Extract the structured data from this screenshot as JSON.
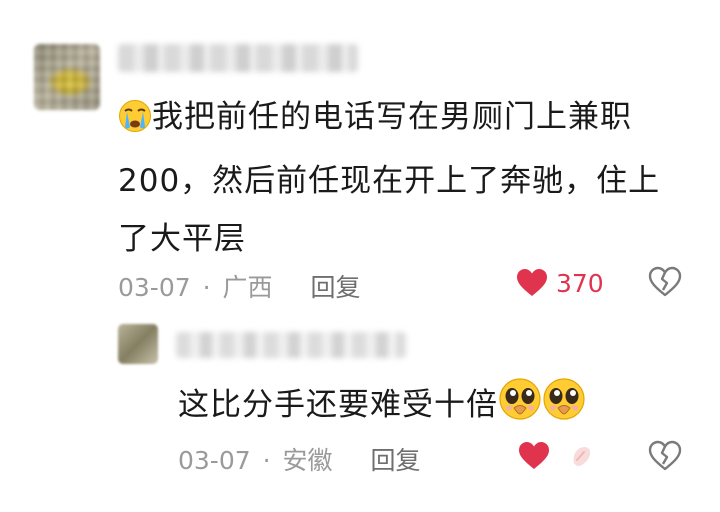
{
  "comment": {
    "text_lines": [
      "我把前任的电话写在男厕门上兼职",
      "200，然后前任现在开上了奔驰，住上",
      "了大平层"
    ],
    "date": "03-07",
    "separator": "·",
    "location": "广西",
    "reply_label": "回复",
    "like_count": "370",
    "liked": true,
    "leading_icon": "crying-face-icon"
  },
  "reply": {
    "text": "这比分手还要难受十倍",
    "trailing_icons": [
      "pleading-face-icon",
      "pleading-face-icon"
    ],
    "date": "03-07",
    "separator": "·",
    "location": "安徽",
    "reply_label": "回复",
    "liked": true
  },
  "colors": {
    "text": "#1a1a1a",
    "meta": "#9a9a9a",
    "like_red": "#e0334e"
  }
}
